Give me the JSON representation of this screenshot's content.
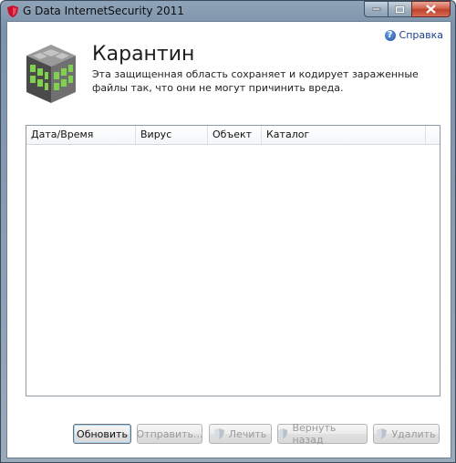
{
  "window": {
    "title": "G Data InternetSecurity 2011",
    "icon": "gdata-shield-icon"
  },
  "header": {
    "help_label": "Справка",
    "title": "Карантин",
    "description": "Эта защищенная область сохраняет и кодирует зараженные файлы так, что они не могут причинить вреда."
  },
  "table": {
    "columns": [
      "Дата/Время",
      "Вирус",
      "Объект",
      "Каталог"
    ],
    "rows": []
  },
  "buttons": {
    "refresh": "Обновить",
    "send": "Отправить...",
    "heal": "Лечить",
    "restore": "Вернуть назад",
    "delete": "Удалить"
  },
  "colors": {
    "titlebar": "#8fa3b8",
    "close_button": "#c0412a",
    "help_link": "#1a3e8c"
  }
}
